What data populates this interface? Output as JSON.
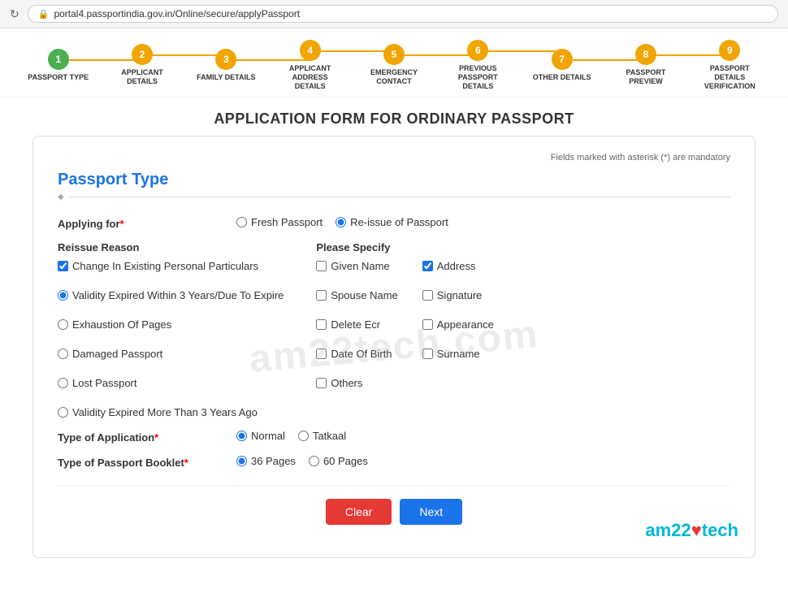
{
  "browser": {
    "url": "portal4.passportindia.gov.in/Online/secure/applyPassport",
    "refresh_icon": "↻",
    "lock_icon": "🔒"
  },
  "steps": [
    {
      "number": "1",
      "label": "PASSPORT TYPE",
      "state": "completed"
    },
    {
      "number": "2",
      "label": "APPLICANT DETAILS",
      "state": "active"
    },
    {
      "number": "3",
      "label": "FAMILY DETAILS",
      "state": "active"
    },
    {
      "number": "4",
      "label": "APPLICANT ADDRESS DETAILS",
      "state": "active"
    },
    {
      "number": "5",
      "label": "EMERGENCY CONTACT",
      "state": "active"
    },
    {
      "number": "6",
      "label": "PREVIOUS PASSPORT DETAILS",
      "state": "active"
    },
    {
      "number": "7",
      "label": "OTHER DETAILS",
      "state": "active"
    },
    {
      "number": "8",
      "label": "PASSPORT PREVIEW",
      "state": "active"
    },
    {
      "number": "9",
      "label": "PASSPORT DETAILS VERIFICATION",
      "state": "active"
    }
  ],
  "page_title": "APPLICATION FORM FOR ORDINARY PASSPORT",
  "mandatory_note": "Fields marked with asterisk (*) are mandatory",
  "section": {
    "title": "Passport Type",
    "diamond": "◆"
  },
  "applying_for": {
    "label": "Applying for",
    "required": "*",
    "options": [
      {
        "id": "fresh",
        "value": "fresh",
        "label": "Fresh Passport",
        "checked": false
      },
      {
        "id": "reissue",
        "value": "reissue",
        "label": "Re-issue of Passport",
        "checked": true
      }
    ]
  },
  "reissue_reason": {
    "title": "Reissue Reason",
    "options": [
      {
        "id": "r1",
        "label": "Change In Existing Personal Particulars",
        "type": "checkbox",
        "checked": true
      },
      {
        "id": "r2",
        "label": "Validity Expired Within 3 Years/Due To Expire",
        "type": "radio",
        "checked": true
      },
      {
        "id": "r3",
        "label": "Exhaustion Of Pages",
        "type": "radio",
        "checked": false
      },
      {
        "id": "r4",
        "label": "Damaged Passport",
        "type": "radio",
        "checked": false
      },
      {
        "id": "r5",
        "label": "Lost Passport",
        "type": "radio",
        "checked": false
      },
      {
        "id": "r6",
        "label": "Validity Expired More Than 3 Years Ago",
        "type": "radio",
        "checked": false
      }
    ]
  },
  "please_specify": {
    "title": "Please Specify",
    "options_left": [
      {
        "id": "s1",
        "label": "Given Name",
        "checked": false
      },
      {
        "id": "s2",
        "label": "Spouse Name",
        "checked": false
      },
      {
        "id": "s3",
        "label": "Delete Ecr",
        "checked": false
      },
      {
        "id": "s4",
        "label": "Date Of Birth",
        "checked": false
      },
      {
        "id": "s5",
        "label": "Others",
        "checked": false
      }
    ],
    "options_right": [
      {
        "id": "s6",
        "label": "Address",
        "checked": true
      },
      {
        "id": "s7",
        "label": "Signature",
        "checked": false
      },
      {
        "id": "s8",
        "label": "Appearance",
        "checked": false
      },
      {
        "id": "s9",
        "label": "Surname",
        "checked": false
      }
    ]
  },
  "type_of_application": {
    "label": "Type of Application",
    "required": "*",
    "options": [
      {
        "id": "normal",
        "label": "Normal",
        "checked": true
      },
      {
        "id": "tatkaal",
        "label": "Tatkaal",
        "checked": false
      }
    ]
  },
  "type_of_booklet": {
    "label": "Type of Passport Booklet",
    "required": "*",
    "options": [
      {
        "id": "p36",
        "label": "36 Pages",
        "checked": true
      },
      {
        "id": "p60",
        "label": "60 Pages",
        "checked": false
      }
    ]
  },
  "buttons": {
    "clear": "Clear",
    "next": "Next"
  },
  "watermark": "am22tech.com",
  "branding": {
    "text_left": "am22",
    "heart": "♥",
    "text_right": "tech"
  }
}
